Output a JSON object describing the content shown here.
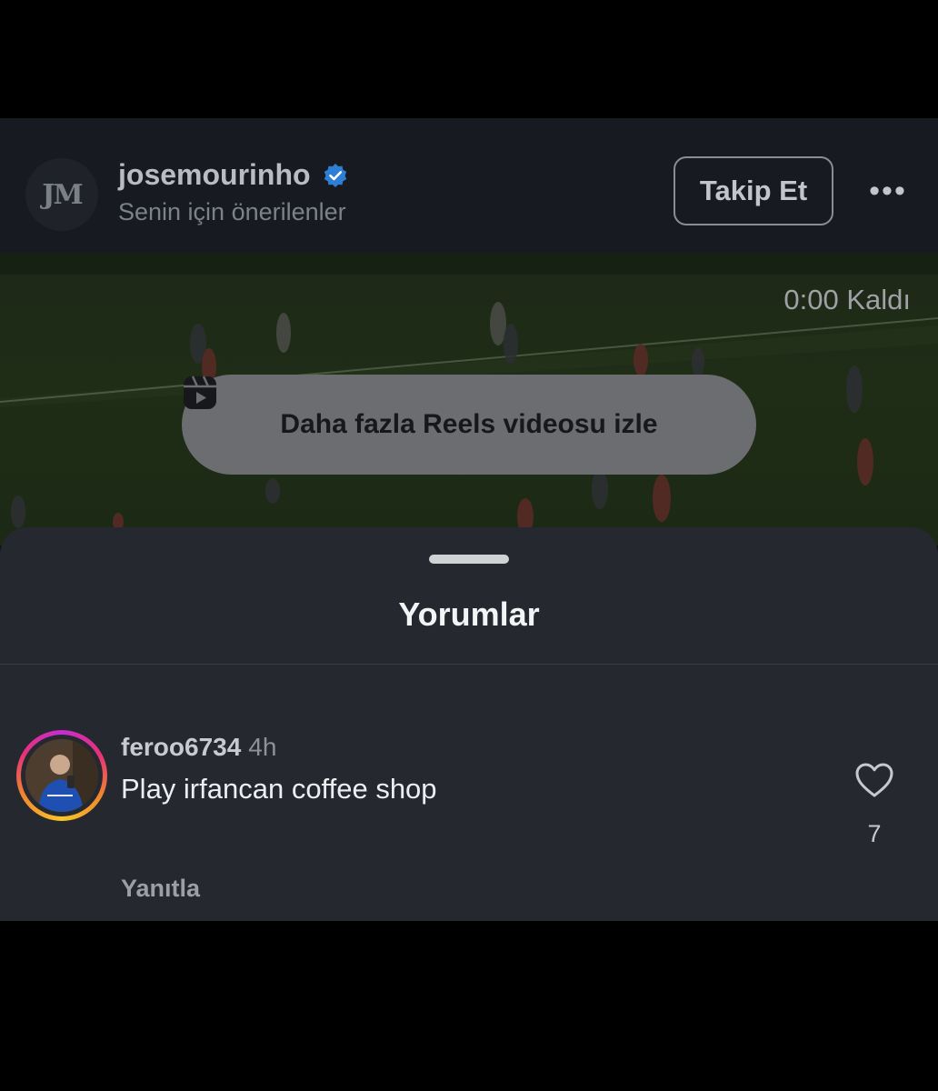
{
  "post": {
    "avatar_text": "JM",
    "username": "josemourinho",
    "subtitle": "Senin için önerilenler",
    "follow_label": "Takip Et",
    "more_label": "•••"
  },
  "video": {
    "time_left": "0:00 Kaldı",
    "reels_button_label": "Daha fazla Reels videosu izle"
  },
  "comments_sheet": {
    "title": "Yorumlar",
    "comments": [
      {
        "username": "feroo6734",
        "time": "4h",
        "text": "Play irfancan coffee shop",
        "likes": "7",
        "reply_label": "Yanıtla"
      }
    ]
  },
  "colors": {
    "verified": "#3897f0",
    "sheet_bg": "#25282f",
    "header_bg": "#171a20"
  }
}
